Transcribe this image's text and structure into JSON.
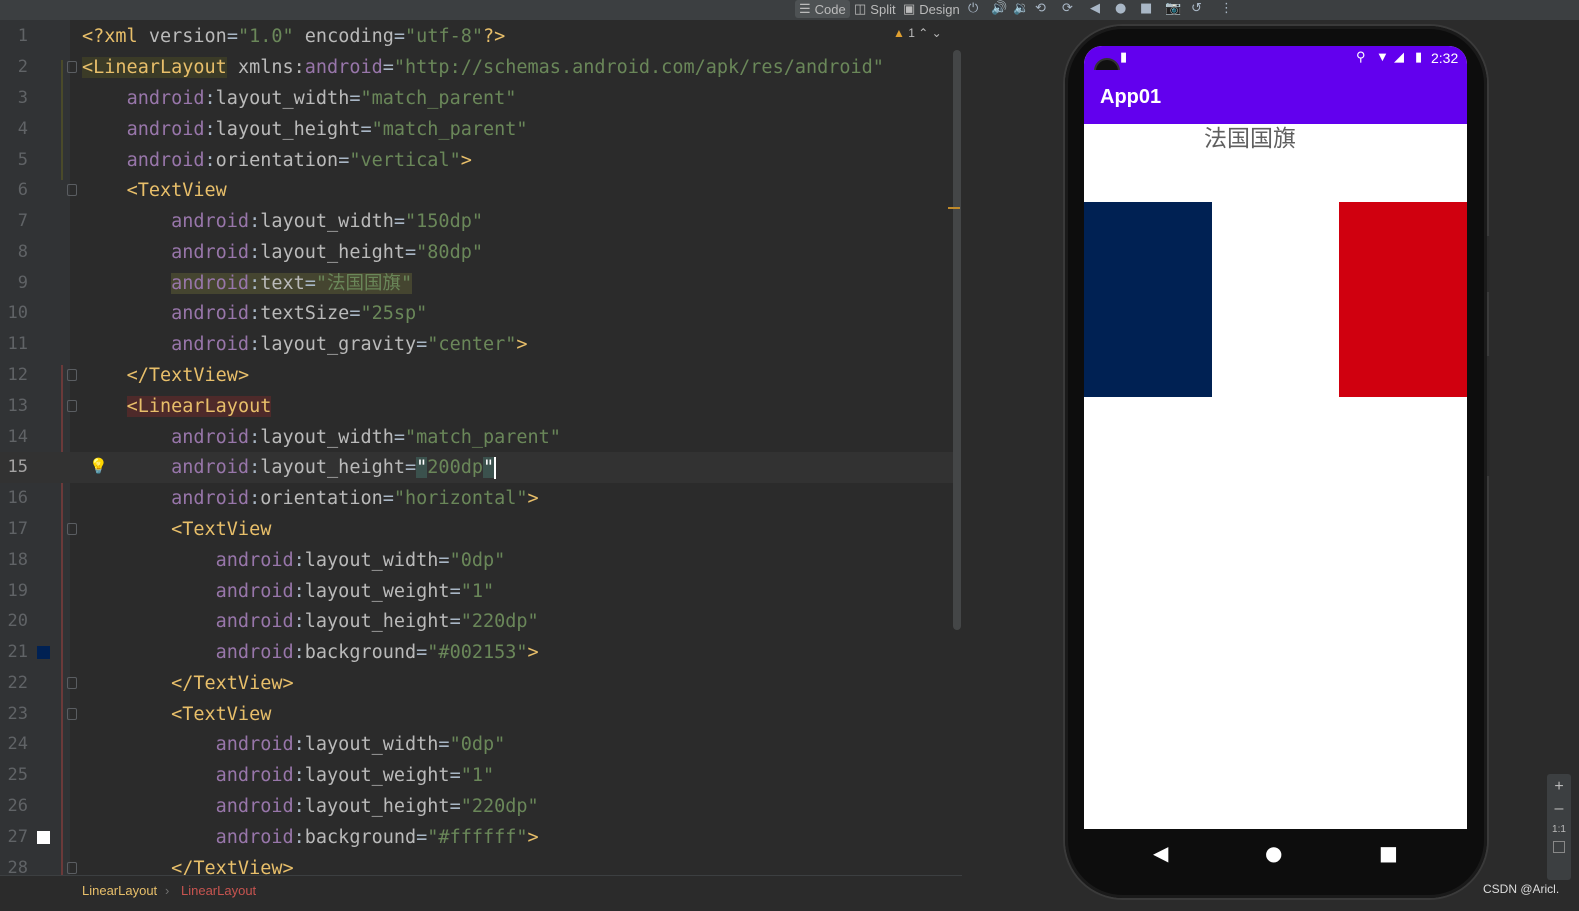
{
  "toolbar": {
    "code_label": "Code",
    "split_label": "Split",
    "design_label": "Design"
  },
  "editor": {
    "warning_count": "1",
    "lines": [
      {
        "num": "1"
      },
      {
        "num": "2"
      },
      {
        "num": "3"
      },
      {
        "num": "4"
      },
      {
        "num": "5"
      },
      {
        "num": "6"
      },
      {
        "num": "7"
      },
      {
        "num": "8"
      },
      {
        "num": "9"
      },
      {
        "num": "10"
      },
      {
        "num": "11"
      },
      {
        "num": "12"
      },
      {
        "num": "13"
      },
      {
        "num": "14"
      },
      {
        "num": "15"
      },
      {
        "num": "16"
      },
      {
        "num": "17"
      },
      {
        "num": "18"
      },
      {
        "num": "19"
      },
      {
        "num": "20"
      },
      {
        "num": "21"
      },
      {
        "num": "22"
      },
      {
        "num": "23"
      },
      {
        "num": "24"
      },
      {
        "num": "25"
      },
      {
        "num": "26"
      },
      {
        "num": "27"
      },
      {
        "num": "28"
      }
    ],
    "swatch_colors": {
      "line21": "#002153",
      "line27": "#ffffff"
    }
  },
  "breadcrumb": {
    "item1": "LinearLayout",
    "separator": "›",
    "item2": "LinearLayout"
  },
  "device": {
    "status_time": "2:32",
    "app_title": "App01",
    "flag_title": "法国国旗",
    "flag_colors": {
      "blue": "#002153",
      "white": "#ffffff",
      "red": "#d0000f"
    },
    "nav": {
      "back": "◀",
      "home": "●",
      "recents": "■"
    }
  },
  "zoom": {
    "plus": "+",
    "minus": "–",
    "fit": "1:1"
  },
  "watermark": "CSDN @Aricl."
}
